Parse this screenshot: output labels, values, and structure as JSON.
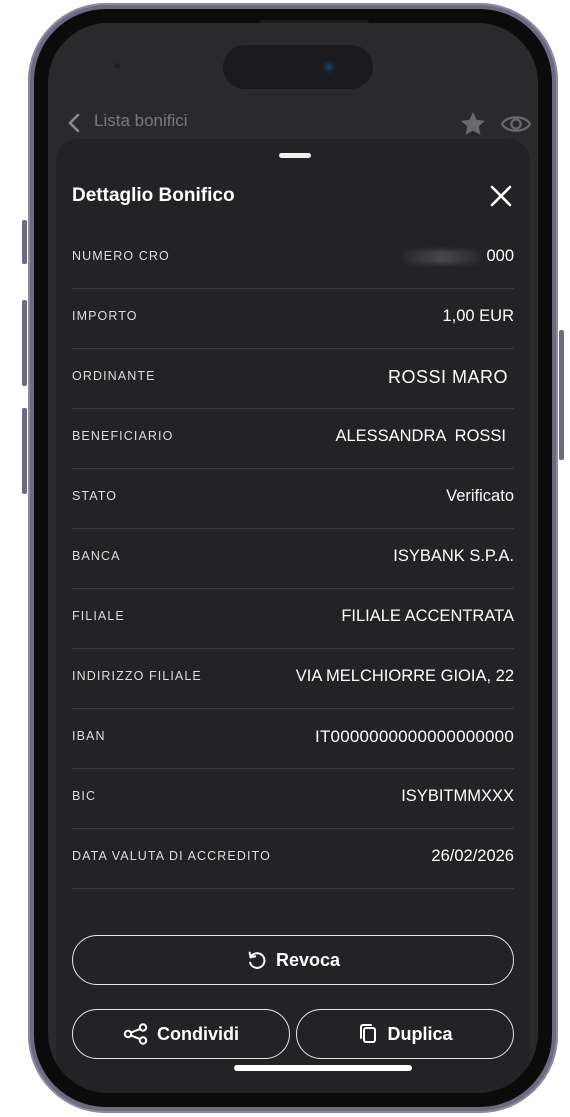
{
  "topbar": {
    "back_label": "Lista bonifici"
  },
  "sheet": {
    "title": "Dettaglio Bonifico",
    "rows": [
      {
        "label": "NUMERO CRO",
        "value": "000"
      },
      {
        "label": "IMPORTO",
        "value": "1,00 EUR"
      },
      {
        "label": "ORDINANTE",
        "value": "ROSSI MARO"
      },
      {
        "label": "BENEFICIARIO",
        "value": "ALESSANDRA  ROSSI"
      },
      {
        "label": "STATO",
        "value": "Verificato"
      },
      {
        "label": "BANCA",
        "value": "ISYBANK S.P.A."
      },
      {
        "label": "FILIALE",
        "value": "FILIALE ACCENTRATA"
      },
      {
        "label": "INDIRIZZO FILIALE",
        "value": "VIA MELCHIORRE GIOIA, 22"
      },
      {
        "label": "IBAN",
        "value": "IT0000000000000000000"
      },
      {
        "label": "BIC",
        "value": "ISYBITMMXXX"
      },
      {
        "label": "DATA VALUTA DI ACCREDITO",
        "value": "26/02/2026"
      }
    ]
  },
  "actions": {
    "revoca": "Revoca",
    "condividi": "Condividi",
    "duplica": "Duplica"
  },
  "icons": {
    "back": "chevron-left-icon",
    "favorite": "star-icon",
    "visibility": "eye-icon",
    "close": "close-icon",
    "revoke": "rotate-ccw-icon",
    "share": "share-icon",
    "duplicate": "copy-icon"
  },
  "colors": {
    "sheet_background": "#232325",
    "screen_background": "#2a2a2c",
    "text_primary": "#ffffff",
    "divider": "#3a3a3d",
    "frame": "#6e6a80"
  }
}
